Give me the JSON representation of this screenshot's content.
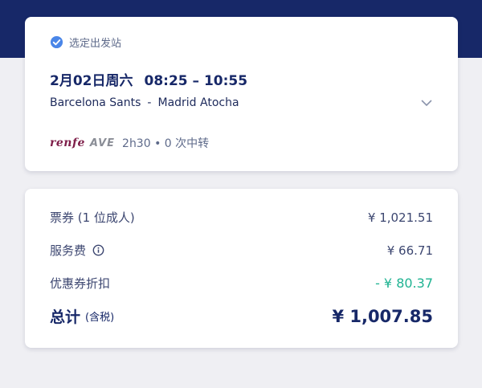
{
  "trip": {
    "selected_label": "选定出发站",
    "date": "2月02日周六",
    "time_range": "08:25 – 10:55",
    "origin": "Barcelona Sants",
    "separator": "-",
    "destination": "Madrid Atocha",
    "carrier_logo": "renfe",
    "train_type_logo": "AVE",
    "duration_transfers": "2h30 • 0 次中转",
    "icons": [
      "check-circle-icon",
      "chevron-down-icon"
    ]
  },
  "price": {
    "ticket_label": "票券 (1 位成人)",
    "ticket_value": "¥ 1,021.51",
    "service_label": "服务费",
    "service_value": "¥ 66.71",
    "discount_label": "优惠券折扣",
    "discount_value": "- ¥ 80.37",
    "total_label": "总计",
    "total_sub": "(含税)",
    "total_value": "¥ 1,007.85"
  },
  "colors": {
    "header": "#172868",
    "accent_blue": "#4a86e8",
    "discount_green": "#1fb392",
    "renfe": "#7e1e49"
  }
}
